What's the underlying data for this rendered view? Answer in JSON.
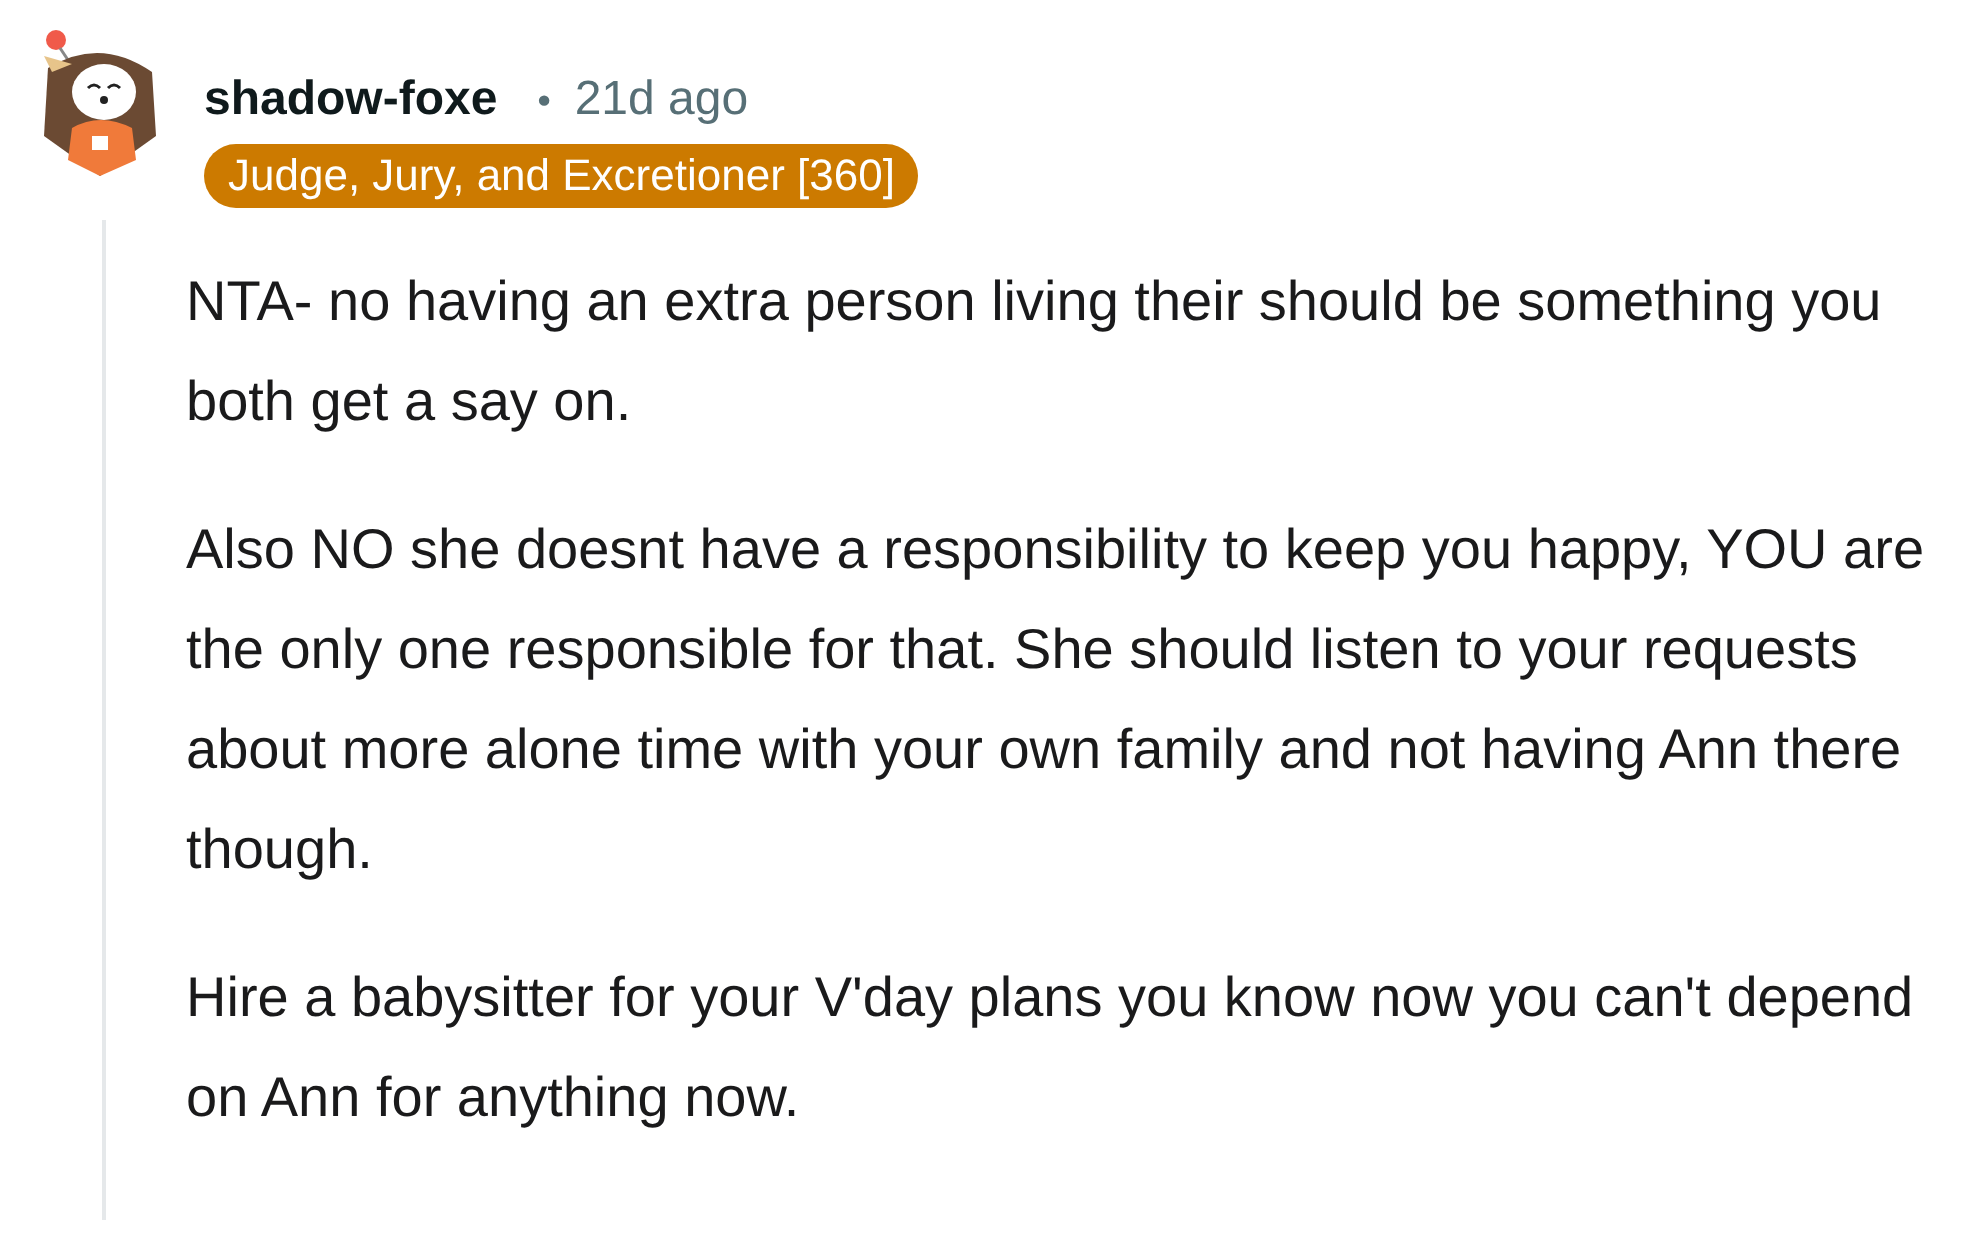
{
  "comment": {
    "author": "shadow-foxe",
    "separator": "•",
    "time": "21d ago",
    "flair": {
      "text": "Judge, Jury, and Excretioner [360]",
      "color": "#cc7a00"
    },
    "paragraphs": [
      "NTA- no having an extra person living their should be something you both get a say on.",
      "Also NO she doesnt have a responsibility to keep you happy, YOU are the only one responsible for that. She should listen to your requests about more alone time with your own family and not having Ann there though.",
      "Hire a babysitter for your V'day plans you know now you can't depend on Ann for anything now."
    ]
  }
}
